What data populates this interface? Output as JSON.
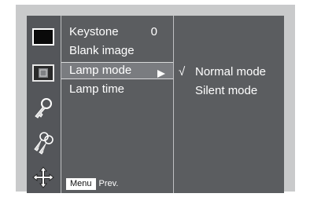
{
  "menu": {
    "items": [
      {
        "label": "Keystone",
        "value": "0"
      },
      {
        "label": "Blank image",
        "value": ""
      },
      {
        "label": "Lamp mode",
        "value": ""
      },
      {
        "label": "Lamp time",
        "value": ""
      }
    ],
    "selected_index": 2
  },
  "submenu": {
    "items": [
      {
        "label": "Normal mode",
        "checked": true,
        "check_mark": "√"
      },
      {
        "label": "Silent mode",
        "checked": false,
        "check_mark": ""
      }
    ]
  },
  "footer": {
    "key_label": "Menu",
    "action_label": "Prev."
  },
  "sidebar": {
    "icons": [
      "picture-icon",
      "screen-icon",
      "key-icon",
      "keys-icon",
      "move-icon"
    ]
  },
  "colors": {
    "osd_background": "#5b5d60",
    "frame": "#c9cacb",
    "highlight": "#7a7c80",
    "text": "#ffffff"
  }
}
